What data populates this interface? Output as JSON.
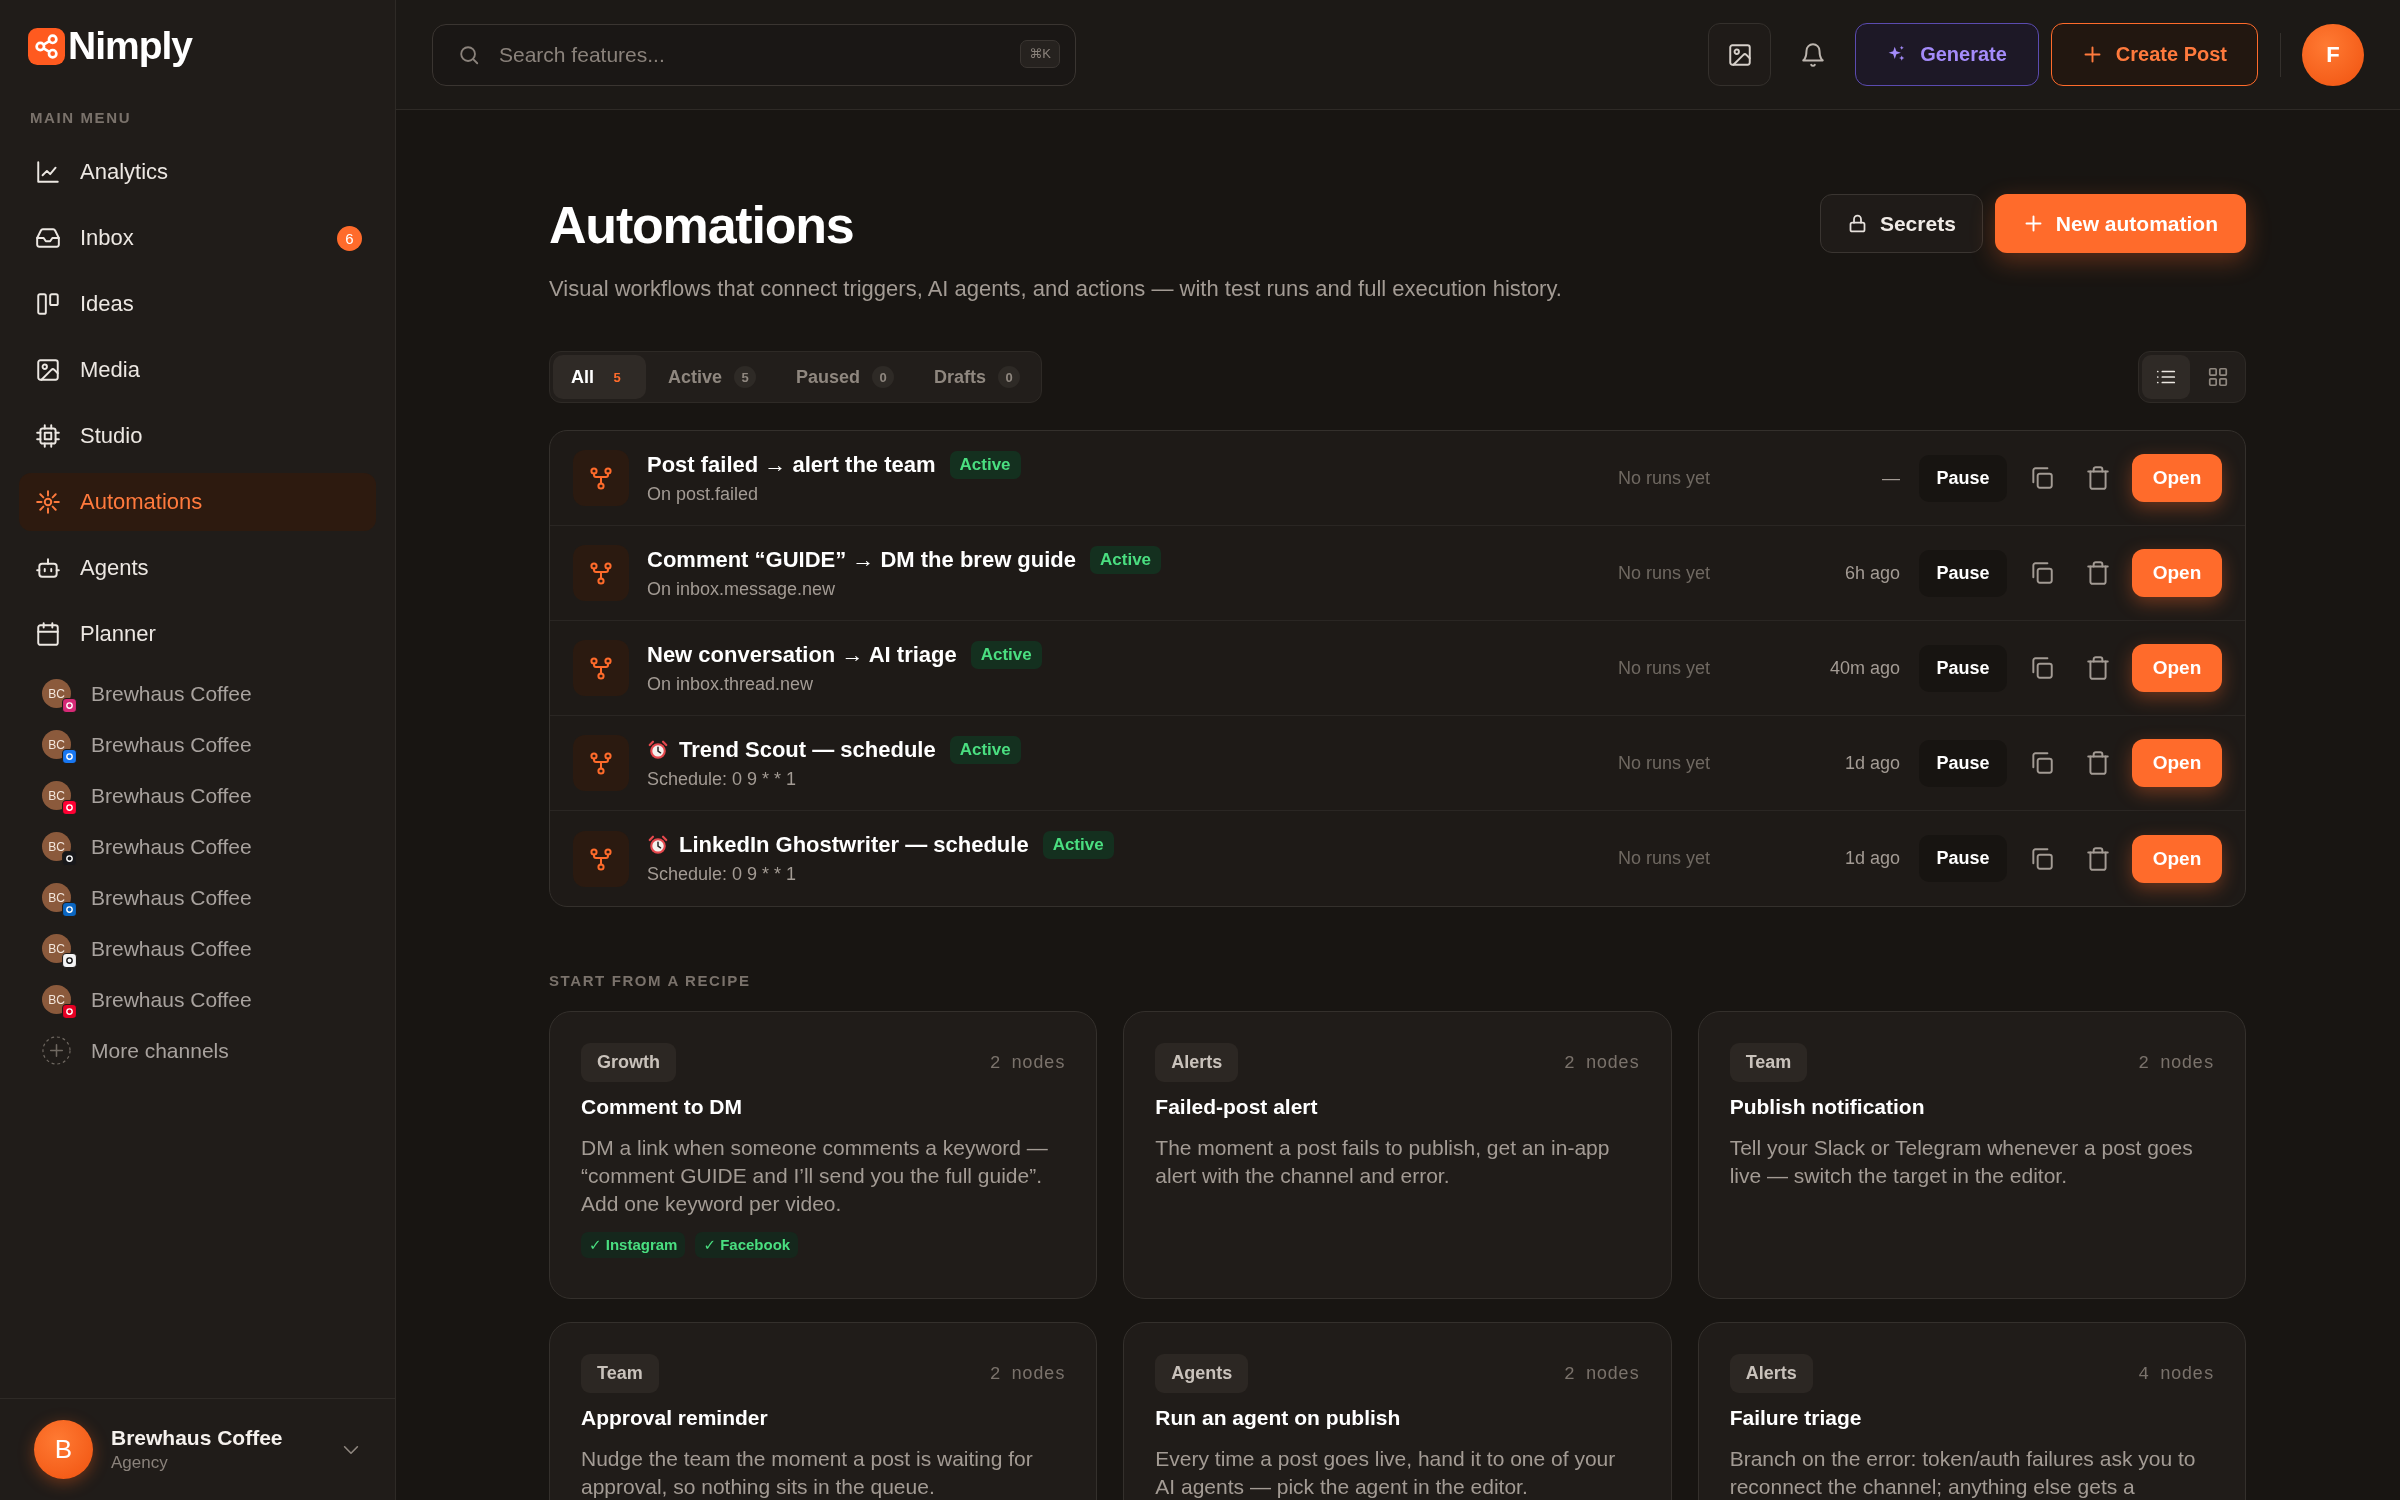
{
  "sidebar": {
    "logo": "Nimply",
    "section_label": "MAIN MENU",
    "menu": [
      {
        "label": "Analytics",
        "selected": false
      },
      {
        "label": "Inbox",
        "selected": false,
        "badge": "6"
      },
      {
        "label": "Ideas",
        "selected": false
      },
      {
        "label": "Media",
        "selected": false
      },
      {
        "label": "Studio",
        "selected": false
      },
      {
        "label": "Automations",
        "selected": true
      },
      {
        "label": "Agents",
        "selected": false
      },
      {
        "label": "Planner",
        "selected": false
      }
    ],
    "channels": [
      {
        "initials": "BC",
        "name": "Brewhaus Coffee",
        "color": "#d62976"
      },
      {
        "initials": "BC",
        "name": "Brewhaus Coffee",
        "color": "#1877f2"
      },
      {
        "initials": "BC",
        "name": "Brewhaus Coffee",
        "color": "#ff0033"
      },
      {
        "initials": "BC",
        "name": "Brewhaus Coffee",
        "color": "#18181b"
      },
      {
        "initials": "BC",
        "name": "Brewhaus Coffee",
        "color": "#0a66c2"
      },
      {
        "initials": "BC",
        "name": "Brewhaus Coffee",
        "color": "#f4f4f5"
      },
      {
        "initials": "BC",
        "name": "Brewhaus Coffee",
        "color": "#e60023"
      }
    ],
    "more_channels": "More channels",
    "account": {
      "initial": "B",
      "name": "Brewhaus Coffee",
      "role": "Agency"
    }
  },
  "topbar": {
    "search": {
      "placeholder": "Search features...",
      "shortcut": "⌘K"
    },
    "generate": "Generate",
    "create_post": "Create Post",
    "avatar": "F"
  },
  "header": {
    "title": "Automations",
    "subtitle": "Visual workflows that connect triggers, AI agents, and actions — with test runs and full execution history.",
    "secrets": "Secrets",
    "new_automation": "New automation"
  },
  "filters": [
    {
      "label": "All",
      "count": "5",
      "selected": true
    },
    {
      "label": "Active",
      "count": "5",
      "selected": false
    },
    {
      "label": "Paused",
      "count": "0",
      "selected": false
    },
    {
      "label": "Drafts",
      "count": "0",
      "selected": false
    }
  ],
  "view_toggle": [
    {
      "kind": "list",
      "selected": true
    },
    {
      "kind": "grid",
      "selected": false
    }
  ],
  "automations": [
    {
      "kind": "event",
      "title": "Post failed → alert the team",
      "status": "Active",
      "trigger": "On post.failed",
      "runs": "No runs yet",
      "time": "—",
      "pause": "Pause",
      "open": "Open"
    },
    {
      "kind": "event",
      "title": "Comment “GUIDE” → DM the brew guide",
      "status": "Active",
      "trigger": "On inbox.message.new",
      "runs": "No runs yet",
      "time": "6h ago",
      "pause": "Pause",
      "open": "Open"
    },
    {
      "kind": "event",
      "title": "New conversation → AI triage",
      "status": "Active",
      "trigger": "On inbox.thread.new",
      "runs": "No runs yet",
      "time": "40m ago",
      "pause": "Pause",
      "open": "Open"
    },
    {
      "kind": "schedule",
      "title": "Trend Scout — schedule",
      "status": "Active",
      "trigger": "Schedule: 0 9 * * 1",
      "runs": "No runs yet",
      "time": "1d ago",
      "pause": "Pause",
      "open": "Open"
    },
    {
      "kind": "schedule",
      "title": "LinkedIn Ghostwriter — schedule",
      "status": "Active",
      "trigger": "Schedule: 0 9 * * 1",
      "runs": "No runs yet",
      "time": "1d ago",
      "pause": "Pause",
      "open": "Open"
    }
  ],
  "recipes_label": "START FROM A RECIPE",
  "recipes": [
    {
      "tag": "Growth",
      "nodes": "2 nodes",
      "title": "Comment to DM",
      "description": "DM a link when someone comments a keyword — “comment GUIDE and I’ll send you the full guide”. Add one keyword per video.",
      "channels": [
        "✓ Instagram",
        "✓ Facebook"
      ]
    },
    {
      "tag": "Alerts",
      "nodes": "2 nodes",
      "title": "Failed-post alert",
      "description": "The moment a post fails to publish, get an in-app alert with the channel and error."
    },
    {
      "tag": "Team",
      "nodes": "2 nodes",
      "title": "Publish notification",
      "description": "Tell your Slack or Telegram whenever a post goes live — switch the target in the editor."
    },
    {
      "tag": "Team",
      "nodes": "2 nodes",
      "title": "Approval reminder",
      "description": "Nudge the team the moment a post is waiting for approval, so nothing sits in the queue."
    },
    {
      "tag": "Agents",
      "nodes": "2 nodes",
      "title": "Run an agent on publish",
      "description": "Every time a post goes live, hand it to one of your AI agents — pick the agent in the editor."
    },
    {
      "tag": "Alerts",
      "nodes": "4 nodes",
      "title": "Failure triage",
      "description": "Branch on the error: token/auth failures ask you to reconnect the channel; anything else gets a"
    }
  ]
}
